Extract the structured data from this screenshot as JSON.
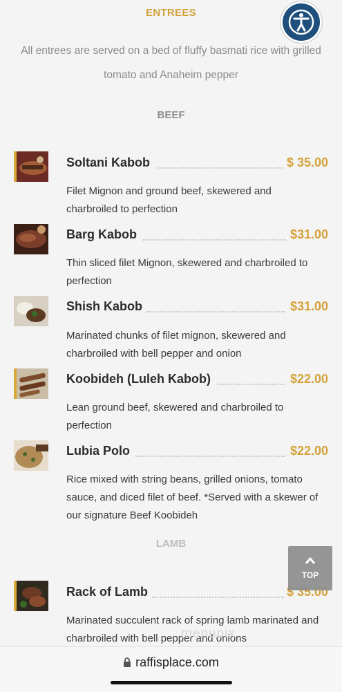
{
  "header": {
    "title": "ENTREES",
    "intro": "All entrees are served on a bed of fluffy basmati rice with grilled tomato and Anaheim pepper"
  },
  "sections": {
    "beef": "BEEF",
    "lamb": "LAMB"
  },
  "items": [
    {
      "name": "Soltani Kabob",
      "price": "$ 35.00",
      "desc": "Filet Mignon and ground beef, skewered and charbroiled to perfection"
    },
    {
      "name": "Barg Kabob",
      "price": "$31.00",
      "desc": "Thin sliced filet Mignon, skewered and charbroiled to perfection"
    },
    {
      "name": "Shish Kabob",
      "price": "$31.00",
      "desc": "Marinated chunks of filet mignon, skewered and charbroiled with bell pepper and onion"
    },
    {
      "name": "Koobideh (Luleh Kabob)",
      "price": "$22.00",
      "desc": "Lean ground beef, skewered and charbroiled to perfection"
    },
    {
      "name": "Lubia Polo",
      "price": "$22.00",
      "desc": "Rice mixed with string beans, grilled onions, tomato sauce, and diced filet of beef. *Served with a skewer of our signature Beef Koobideh"
    },
    {
      "name": "Rack of Lamb",
      "price": "$ 35.00",
      "desc": "Marinated succulent rack of spring lamb marinated and charbroiled with bell pepper and onions"
    }
  ],
  "controls": {
    "top_label": "TOP",
    "accessibility_icon": "accessibility-icon"
  },
  "watermark": "menupix",
  "browser": {
    "url": "raffisplace.com"
  },
  "colors": {
    "accent": "#d4a23a",
    "accessibility_bg": "#1f4f7d",
    "background": "#f4f4f4"
  }
}
